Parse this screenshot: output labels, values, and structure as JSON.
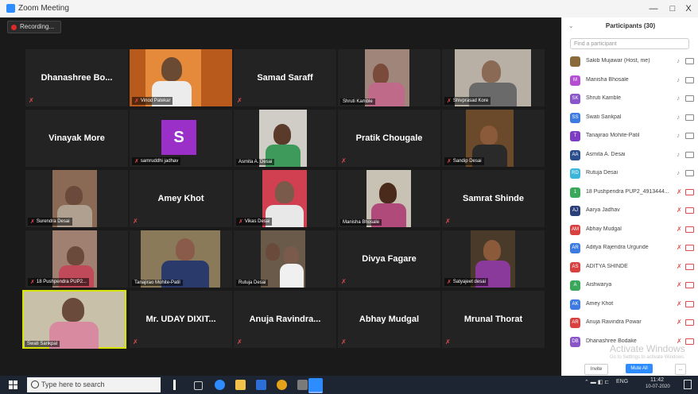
{
  "window": {
    "title": "Zoom Meeting",
    "controls": [
      "—",
      "□",
      "X"
    ]
  },
  "recording": {
    "label": "Recording..."
  },
  "tiles": [
    {
      "name": "Dhanashree Bo...",
      "label": ""
    },
    {
      "name": "",
      "label": "Vinod Patekar"
    },
    {
      "name": "Samad Saraff",
      "label": ""
    },
    {
      "name": "",
      "label": "Shruti Kamble"
    },
    {
      "name": "",
      "label": "Shivprasad Kore"
    },
    {
      "name": "Vinayak More",
      "label": ""
    },
    {
      "name": "",
      "label": "samruddhi jadhav",
      "avatar_letter": "S"
    },
    {
      "name": "",
      "label": "Asmita A. Desai"
    },
    {
      "name": "Pratik Chougale",
      "label": ""
    },
    {
      "name": "",
      "label": "Sandip Desai"
    },
    {
      "name": "",
      "label": "Surendra Desai"
    },
    {
      "name": "Amey Khot",
      "label": ""
    },
    {
      "name": "",
      "label": "Vikas Desai"
    },
    {
      "name": "",
      "label": "Manisha Bhosale"
    },
    {
      "name": "Samrat Shinde",
      "label": ""
    },
    {
      "name": "",
      "label": "18 Pushpendra PUP2..."
    },
    {
      "name": "",
      "label": "Tanajirao Mohite-Patil"
    },
    {
      "name": "",
      "label": "Rutuja Desai"
    },
    {
      "name": "Divya Fagare",
      "label": ""
    },
    {
      "name": "",
      "label": "Satyajeet desai"
    },
    {
      "name": "",
      "label": "Swati Sankpal"
    },
    {
      "name": "Mr. UDAY DIXIT...",
      "label": ""
    },
    {
      "name": "Anuja Ravindra...",
      "label": ""
    },
    {
      "name": "Abhay Mudgal",
      "label": ""
    },
    {
      "name": "Mrunal Thorat",
      "label": ""
    }
  ],
  "participants_panel": {
    "title": "Participants (30)",
    "search_placeholder": "Find a participant",
    "items": [
      {
        "initials": "",
        "name": "Sakib Mujawar (Host, me)",
        "color": "#8a6a3a"
      },
      {
        "initials": "M",
        "name": "Manisha Bhosale",
        "color": "#b44fd3"
      },
      {
        "initials": "SK",
        "name": "Shruti Kamble",
        "color": "#8a55c9"
      },
      {
        "initials": "SS",
        "name": "Swati Sankpal",
        "color": "#3d7be3"
      },
      {
        "initials": "T",
        "name": "Tanajirao Mohite-Patil",
        "color": "#7c3cc4"
      },
      {
        "initials": "AA",
        "name": "Asmita A. Desai",
        "color": "#2b4f8c"
      },
      {
        "initials": "RD",
        "name": "Rutuja Desai",
        "color": "#3bb5d9"
      },
      {
        "initials": "1",
        "name": "18 Pushpendra PUP2_4913444...",
        "color": "#3aa85a"
      },
      {
        "initials": "AJ",
        "name": "Aarya Jadhav",
        "color": "#2b3f7a"
      },
      {
        "initials": "AM",
        "name": "Abhay Mudgal",
        "color": "#d94040"
      },
      {
        "initials": "AR",
        "name": "Aditya Rajendra Urgunde",
        "color": "#3d7be3"
      },
      {
        "initials": "AS",
        "name": "ADITYA SHINDE",
        "color": "#d94040"
      },
      {
        "initials": "A",
        "name": "Aishwarya",
        "color": "#3aa85a"
      },
      {
        "initials": "AK",
        "name": "Amey Khot",
        "color": "#3d7be3"
      },
      {
        "initials": "AR",
        "name": "Anuja Ravindra Powar",
        "color": "#d94040"
      },
      {
        "initials": "DB",
        "name": "Dhanashree Bodake",
        "color": "#8a55c9"
      }
    ],
    "invite_label": "Invite",
    "mute_all_label": "Mute All",
    "more_label": "...",
    "watermark": "Activate Windows",
    "watermark_sub": "Go to Settings to activate Windows."
  },
  "taskbar": {
    "search_placeholder": "Type here to search",
    "language": "ENG",
    "time": "11:42",
    "date": "10-07-2020"
  },
  "colors": {
    "accent": "#2d8cff",
    "active_speaker": "#d7e300",
    "muted": "#e24c4c"
  }
}
